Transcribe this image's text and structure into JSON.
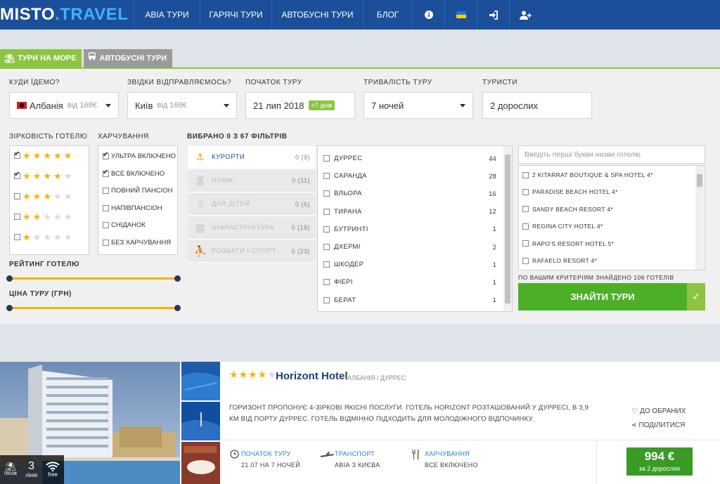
{
  "header": {
    "logo_main": "MISTO",
    "logo_dot": ".",
    "logo_travel": "TRAVEL",
    "nav": [
      "АВІА ТУРИ",
      "ГАРЯЧІ ТУРИ",
      "АВТОБУСНІ ТУРИ",
      "БЛОГ"
    ],
    "icons": [
      "info-icon",
      "flag-ukraine-icon",
      "login-icon",
      "add-user-icon"
    ]
  },
  "tabs": [
    {
      "label": "ТУРИ НА МОРЕ",
      "icon": "beach-icon",
      "active": true
    },
    {
      "label": "АВТОБУСНІ ТУРИ",
      "icon": "bus-icon",
      "active": false
    }
  ],
  "search": {
    "destination": {
      "label": "КУДИ ЇДЕМО?",
      "value": "Албанія",
      "sub": "від 168€"
    },
    "departure": {
      "label": "ЗВІДКИ ВІДПРАВЛЯЄМОСЬ?",
      "value": "Київ",
      "sub": "від 168€"
    },
    "start": {
      "label": "ПОЧАТОК ТУРУ",
      "value": "21 лип 2018",
      "badge": "+7 днів"
    },
    "duration": {
      "label": "ТРИВАЛІСТЬ ТУРУ",
      "value": "7 ночей"
    },
    "tourists": {
      "label": "ТУРИСТИ",
      "value": "2 дорослих"
    }
  },
  "stars": {
    "label": "ЗІРКОВІСТЬ ГОТЕЛЮ",
    "rows": [
      {
        "filled": 5,
        "checked": true
      },
      {
        "filled": 4,
        "checked": true
      },
      {
        "filled": 3,
        "checked": false
      },
      {
        "filled": 2,
        "checked": false
      },
      {
        "filled": 1,
        "checked": false
      }
    ]
  },
  "meals": {
    "label": "ХАРЧУВАННЯ",
    "items": [
      {
        "label": "УЛЬТРА ВКЛЮЧЕНО",
        "checked": true
      },
      {
        "label": "ВСЕ ВКЛЮЧЕНО",
        "checked": true
      },
      {
        "label": "ПОВНИЙ ПАНСІОН",
        "checked": false
      },
      {
        "label": "НАПІВПАНСІОН",
        "checked": false
      },
      {
        "label": "СНІДАНОК",
        "checked": false
      },
      {
        "label": "БЕЗ ХАРЧУВАННЯ",
        "checked": false
      }
    ]
  },
  "rating_label": "РЕЙТИНГ ГОТЕЛЮ",
  "price_label": "ЦІНА ТУРУ (ГРН)",
  "filters_label": "ВИБРАНО 0 З 67 ФІЛЬТРІВ",
  "categories": [
    {
      "label": "КУРОРТИ",
      "count": "0 (9)",
      "icon": "⚓",
      "active": true
    },
    {
      "label": "ПЛЯЖ",
      "count": "0 (11)",
      "icon": "🏝",
      "active": false
    },
    {
      "label": "ДЛЯ ДІТЕЙ",
      "count": "0 (6)",
      "icon": "☃",
      "active": false
    },
    {
      "label": "ІНФРАСТРУКТУРА",
      "count": "0 (18)",
      "icon": "▥",
      "active": false
    },
    {
      "label": "РОЗВАГИ І СПОРТ",
      "count": "0 (23)",
      "icon": "⛹",
      "active": false
    }
  ],
  "resorts": [
    {
      "name": "ДУРРЕС",
      "count": "44"
    },
    {
      "name": "САРАНДА",
      "count": "28"
    },
    {
      "name": "ВЛЬОРА",
      "count": "16"
    },
    {
      "name": "ТИРАНА",
      "count": "12"
    },
    {
      "name": "БУТРИНТІ",
      "count": "1"
    },
    {
      "name": "ДХЕРМІ",
      "count": "2"
    },
    {
      "name": "ШКОДЕР",
      "count": "1"
    },
    {
      "name": "ФІЕРІ",
      "count": "1"
    },
    {
      "name": "БЕРАТ",
      "count": "1"
    }
  ],
  "hotel_search": {
    "placeholder": "Введіть перші букви назви готелю"
  },
  "hotels": [
    "2 KITARRAT BOUTIQUE & SPA HOTEL 4*",
    "PARADISE BEACH HOTEL 4*",
    "SANDY BEACH RESORT 4*",
    "REGINA CITY HOTEL 4*",
    "RAPO'S RESORT HOTEL 5*",
    "RAFAELO RESORT 4*"
  ],
  "found_text": "ПО ВАШИМ КРИТЕРІЯМ ЗНАЙДЕНО 106 ГОТЕЛІВ",
  "find_button": "ЗНАЙТИ ТУРИ",
  "card": {
    "stars": 4,
    "name": "Horizont Hotel",
    "location": "АЛБАНІЯ / ДУРРЕС",
    "description": "ГОРИЗОНТ ПРОПОНУЄ 4-ЗІРКОВІ ЯКІСНІ ПОСЛУГИ. ГОТЕЛЬ HORIZONT РОЗТАШОВАНИЙ У ДУРРЕСІ, В 3,9 КМ ВІД ПОРТУ ДУРРЕС. ГОТЕЛЬ ВІДМІННО ПІДХОДИТЬ ДЛЯ МОЛОДІЖНОГО ВІДПОЧИНКУ.",
    "favorite": "ДО ОБРАНИХ",
    "share": "ПОДІЛИТИСЯ",
    "overlay": {
      "beach": "пісок",
      "line_num": "3",
      "line_lbl": "лінія",
      "wifi": "free"
    },
    "tour_start_label": "ПОЧАТОК ТУРУ",
    "tour_start_value": "21.07 НА 7 НОЧЕЙ",
    "transport_label": "ТРАНСПОРТ",
    "transport_value": "АВІА З КИЄВА",
    "meal_label": "ХАРЧУВАННЯ",
    "meal_value": "ВСЕ ВКЛЮЧЕНО",
    "price": "994 €",
    "price_note": "за 2 дорослих"
  },
  "colors": {
    "header": "#1b4f9a",
    "accent_green": "#8dc441",
    "button_green": "#4caf27",
    "star": "#f5b301",
    "price_green": "#3a9b24"
  }
}
